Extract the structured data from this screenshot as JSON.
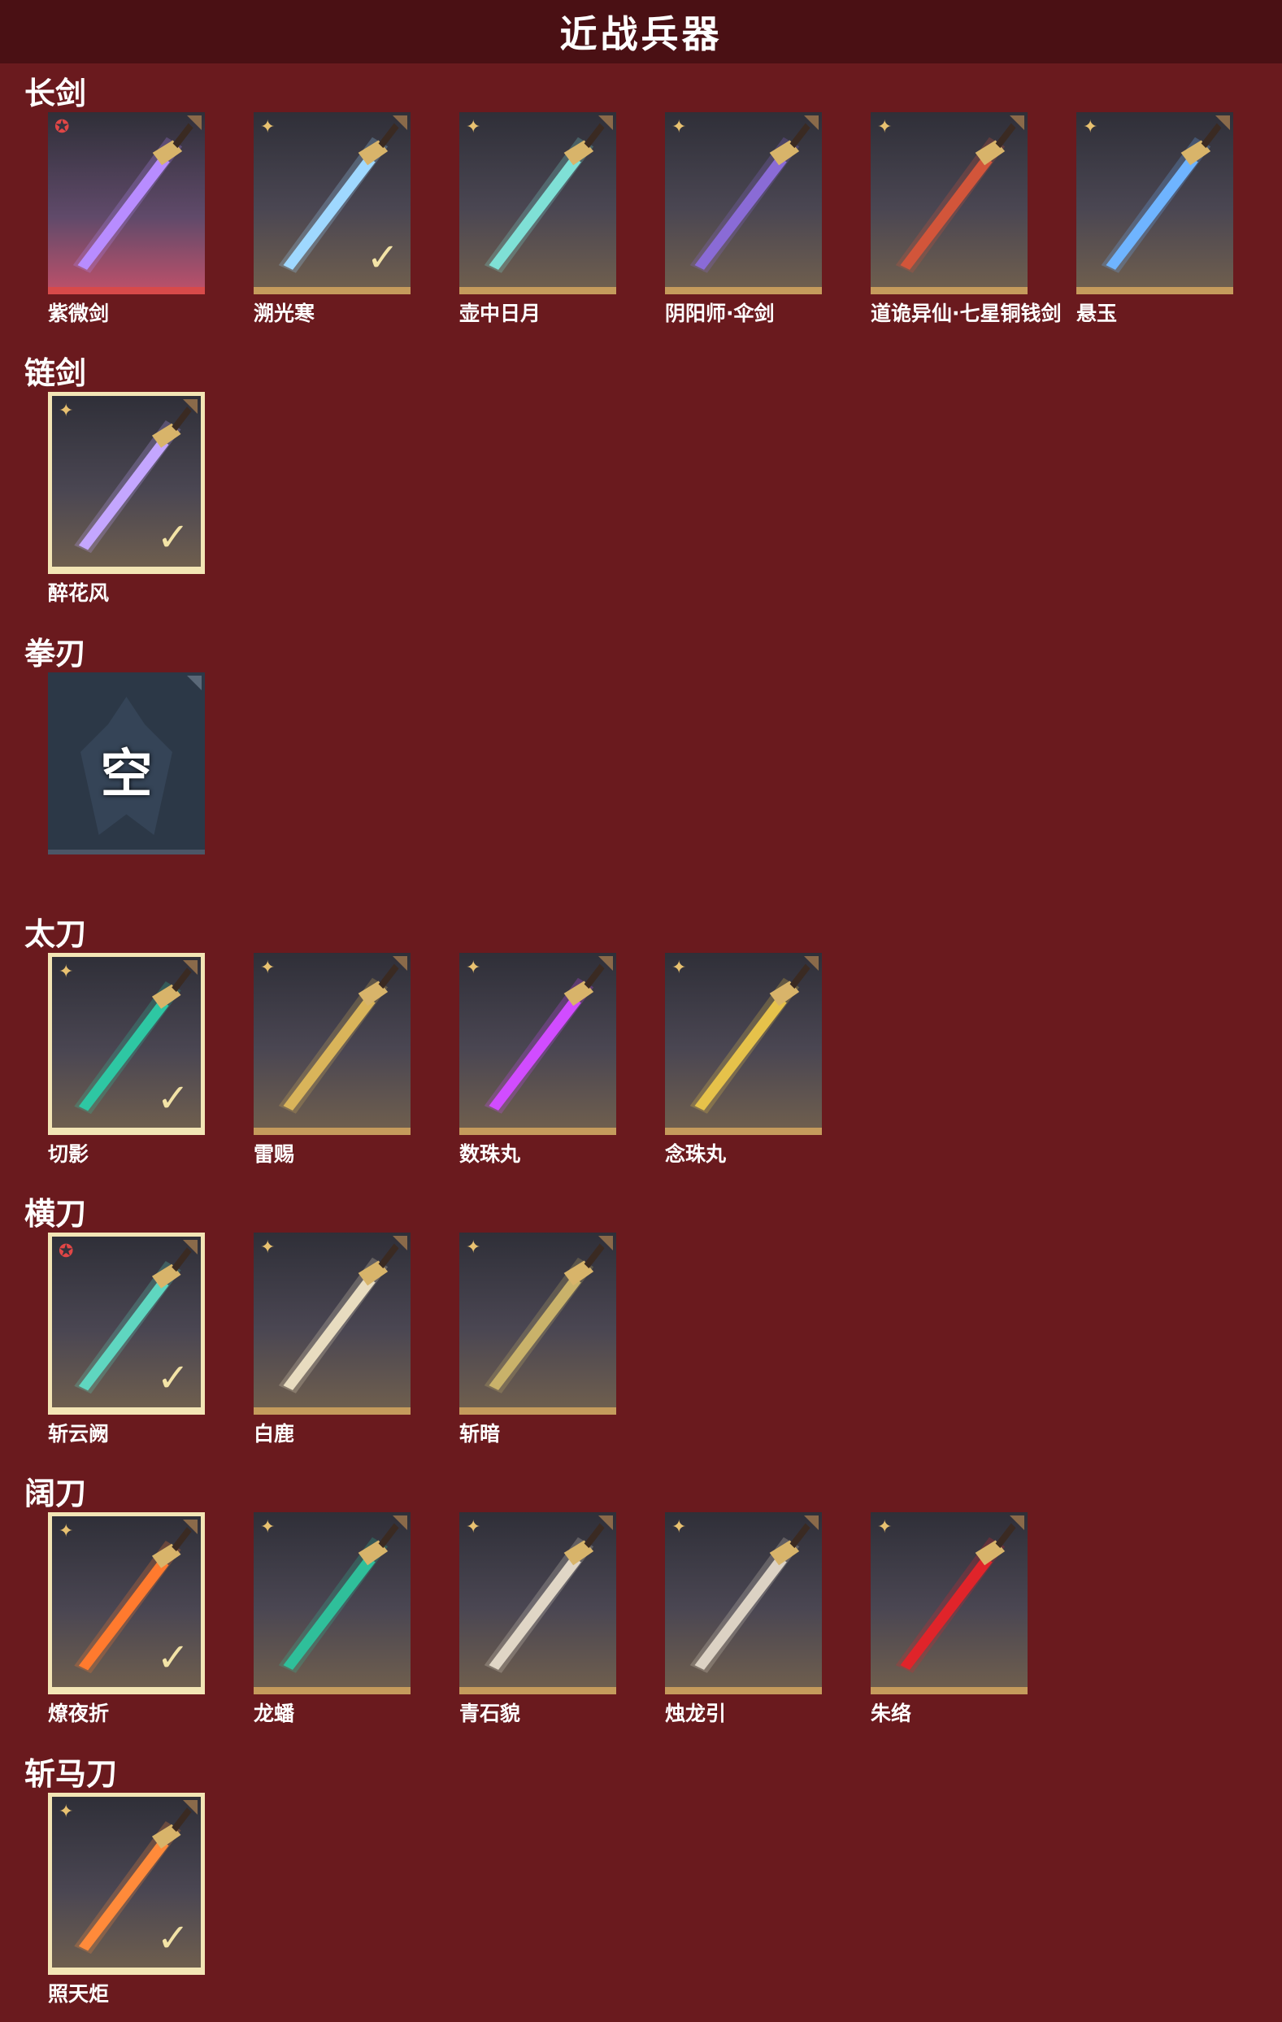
{
  "header": {
    "title": "近战兵器"
  },
  "empty_label": "空",
  "sections": [
    {
      "title": "长剑",
      "items": [
        {
          "name": "紫微剑",
          "star": "red",
          "selected": false,
          "blade": "#b88cff"
        },
        {
          "name": "溯光寒",
          "star": "gold",
          "selected": false,
          "checked": true,
          "blade": "#9fd8ff"
        },
        {
          "name": "壶中日月",
          "star": "gold",
          "selected": false,
          "blade": "#7fe0d6"
        },
        {
          "name": "阴阳师·伞剑",
          "star": "gold",
          "selected": false,
          "blade": "#8a6bd6"
        },
        {
          "name": "道诡异仙·七星铜钱剑",
          "star": "gold",
          "selected": false,
          "blade": "#d2553a"
        },
        {
          "name": "悬玉",
          "star": "gold",
          "selected": false,
          "blade": "#6fb4ff"
        }
      ]
    },
    {
      "title": "链剑",
      "items": [
        {
          "name": "醉花风",
          "star": "gold",
          "selected": true,
          "checked": true,
          "blade": "#c4a6ff"
        }
      ]
    },
    {
      "title": "拳刃",
      "items": [],
      "empty": true
    },
    {
      "title": "太刀",
      "items": [
        {
          "name": "切影",
          "star": "gold",
          "selected": true,
          "checked": true,
          "blade": "#2ec7a3"
        },
        {
          "name": "雷赐",
          "star": "gold",
          "selected": false,
          "blade": "#d9b45a"
        },
        {
          "name": "数珠丸",
          "star": "gold",
          "selected": false,
          "blade": "#d14cff"
        },
        {
          "name": "念珠丸",
          "star": "gold",
          "selected": false,
          "blade": "#e6c24a"
        }
      ]
    },
    {
      "title": "横刀",
      "items": [
        {
          "name": "斩云阙",
          "star": "red",
          "selected": true,
          "checked": true,
          "blade": "#5fd6c0"
        },
        {
          "name": "白鹿",
          "star": "gold",
          "selected": false,
          "blade": "#e8dcc0"
        },
        {
          "name": "斩暗",
          "star": "gold",
          "selected": false,
          "blade": "#c9b26a"
        }
      ]
    },
    {
      "title": "阔刀",
      "items": [
        {
          "name": "燎夜折",
          "star": "gold",
          "selected": true,
          "checked": true,
          "blade": "#ff7a2e"
        },
        {
          "name": "龙蟠",
          "star": "gold",
          "selected": false,
          "blade": "#2fbf9a"
        },
        {
          "name": "青石貌",
          "star": "gold",
          "selected": false,
          "blade": "#e0d6c6"
        },
        {
          "name": "烛龙引",
          "star": "gold",
          "selected": false,
          "blade": "#dcd2c4"
        },
        {
          "name": "朱络",
          "star": "gold",
          "selected": false,
          "blade": "#e0242a"
        }
      ]
    },
    {
      "title": "斩马刀",
      "items": [
        {
          "name": "照天炬",
          "star": "gold",
          "selected": true,
          "checked": true,
          "blade": "#ff8a3a"
        }
      ]
    }
  ]
}
